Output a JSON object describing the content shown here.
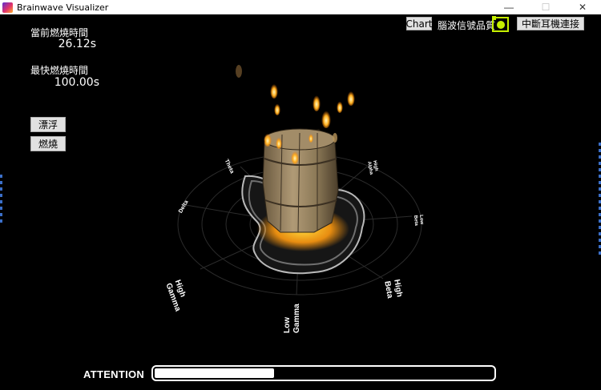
{
  "window": {
    "title": "Brainwave Visualizer",
    "controls": {
      "minimize": "—",
      "maximize": "☐",
      "close": "✕"
    }
  },
  "stats": {
    "current_label": "當前燃燒時間",
    "current_value": "26.12s",
    "fastest_label": "最快燃燒時間",
    "fastest_value": "100.00s"
  },
  "left_buttons": {
    "float": "漂浮",
    "burn": "燃燒"
  },
  "top_right": {
    "chart_button": "Chart",
    "signal_quality_label": "腦波信號品質",
    "disconnect_button": "中斷耳機連接"
  },
  "radar_labels": {
    "theta": "Theta",
    "delta": "Delta",
    "high_gamma": [
      "High",
      "Gamma"
    ],
    "low_gamma": [
      "Low",
      "Gamma"
    ],
    "high_beta": [
      "High",
      "Beta"
    ],
    "low_beta": [
      "Low",
      "Beta"
    ],
    "high_alpha": [
      "High",
      "Alpha"
    ]
  },
  "attention": {
    "label": "ATTENTION",
    "level": 0.36
  },
  "colors": {
    "accent_signal": "#c6f000",
    "fire": "#ffb020"
  }
}
